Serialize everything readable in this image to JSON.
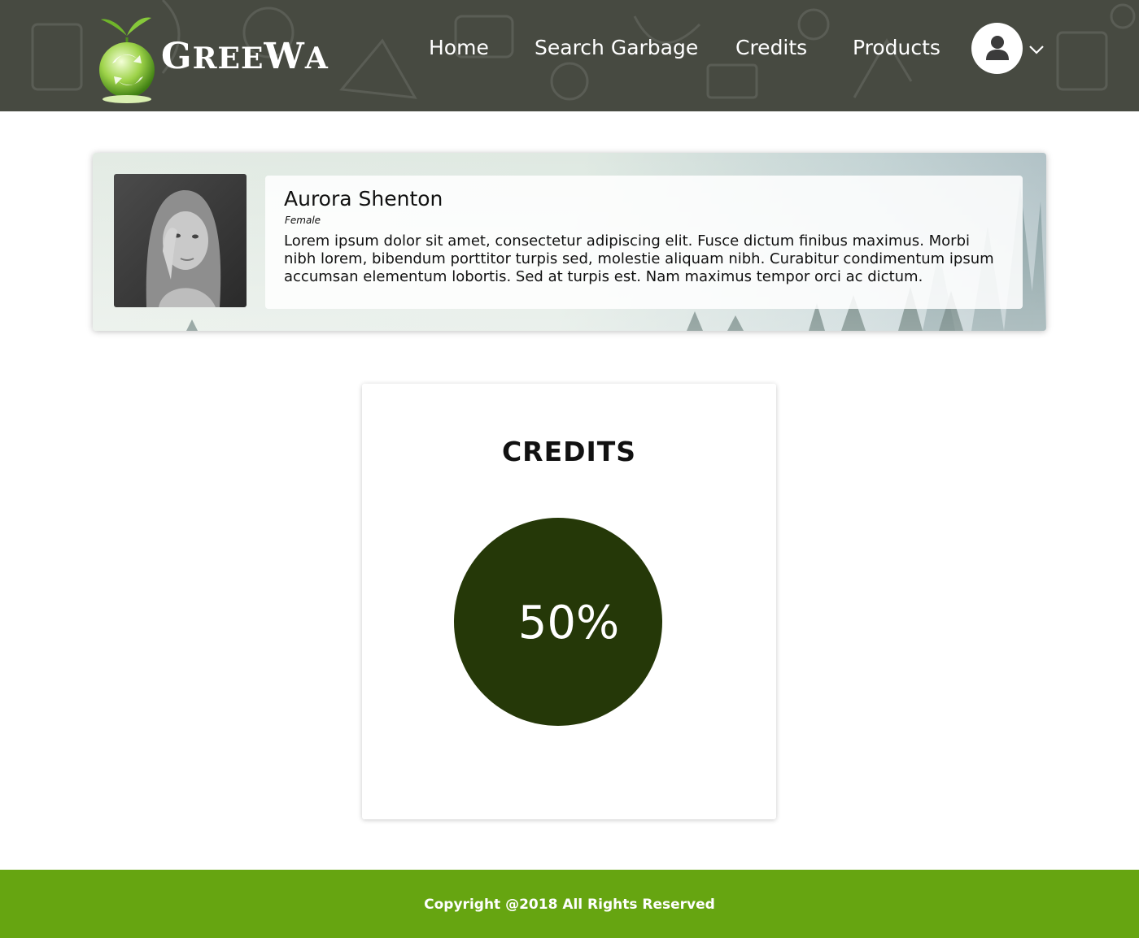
{
  "brand": {
    "name": "GreeWa",
    "name_display": "GREEWA",
    "logo_icon": "recycle-globe-icon"
  },
  "nav": {
    "items": [
      {
        "label": "Home"
      },
      {
        "label": "Search Garbage"
      },
      {
        "label": "Credits"
      },
      {
        "label": "Products"
      }
    ],
    "account_icon": "user-icon",
    "dropdown_icon": "chevron-down-icon"
  },
  "profile": {
    "name": "Aurora Shenton",
    "gender": "Female",
    "bio": "Lorem ipsum dolor sit amet, consectetur adipiscing elit. Fusce dictum finibus maximus. Morbi nibh lorem, bibendum porttitor turpis sed, molestie aliquam nibh. Curabitur condimentum ipsum accumsan elementum lobortis. Sed at turpis est. Nam maximus tempor orci ac dictum."
  },
  "credits": {
    "title": "CREDITS",
    "value": "50%",
    "percent": 50
  },
  "footer": {
    "copyright": "Copyright @2018 All Rights Reserved"
  },
  "colors": {
    "header_bg": "#474a41",
    "credits_circle": "#253808",
    "footer_bg": "#66a511"
  }
}
